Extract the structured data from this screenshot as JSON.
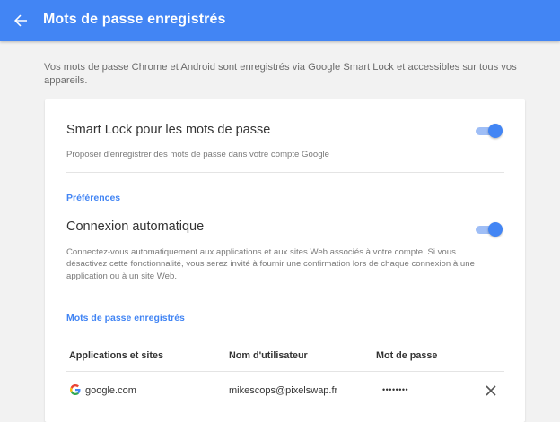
{
  "header": {
    "title": "Mots de passe enregistrés"
  },
  "intro": {
    "text": "Vos mots de passe Chrome et Android sont enregistrés via Google Smart Lock et accessibles sur tous vos appareils."
  },
  "smart_lock": {
    "title": "Smart Lock pour les mots de passe",
    "description": "Proposer d'enregistrer des mots de passe dans votre compte Google",
    "enabled": true
  },
  "preferences": {
    "label": "Préférences",
    "auto_signin": {
      "title": "Connexion automatique",
      "description": "Connectez-vous automatiquement aux applications et aux sites Web associés à votre compte. Si vous désactivez cette fonctionnalité, vous serez invité à fournir une confirmation lors de chaque connexion à une application ou à un site Web.",
      "enabled": true
    }
  },
  "saved_passwords": {
    "label": "Mots de passe enregistrés",
    "columns": {
      "site": "Applications et sites",
      "username": "Nom d'utilisateur",
      "password": "Mot de passe"
    },
    "rows": [
      {
        "site": "google.com",
        "username": "mikescops@pixelswap.fr",
        "password": "••••••••"
      }
    ]
  },
  "colors": {
    "accent": "#4285f4",
    "toggle_track": "#9fbef6",
    "background": "#f2f2f2"
  },
  "icons": {
    "back": "arrow-left-icon",
    "site": "google-g-icon",
    "delete": "close-icon"
  }
}
